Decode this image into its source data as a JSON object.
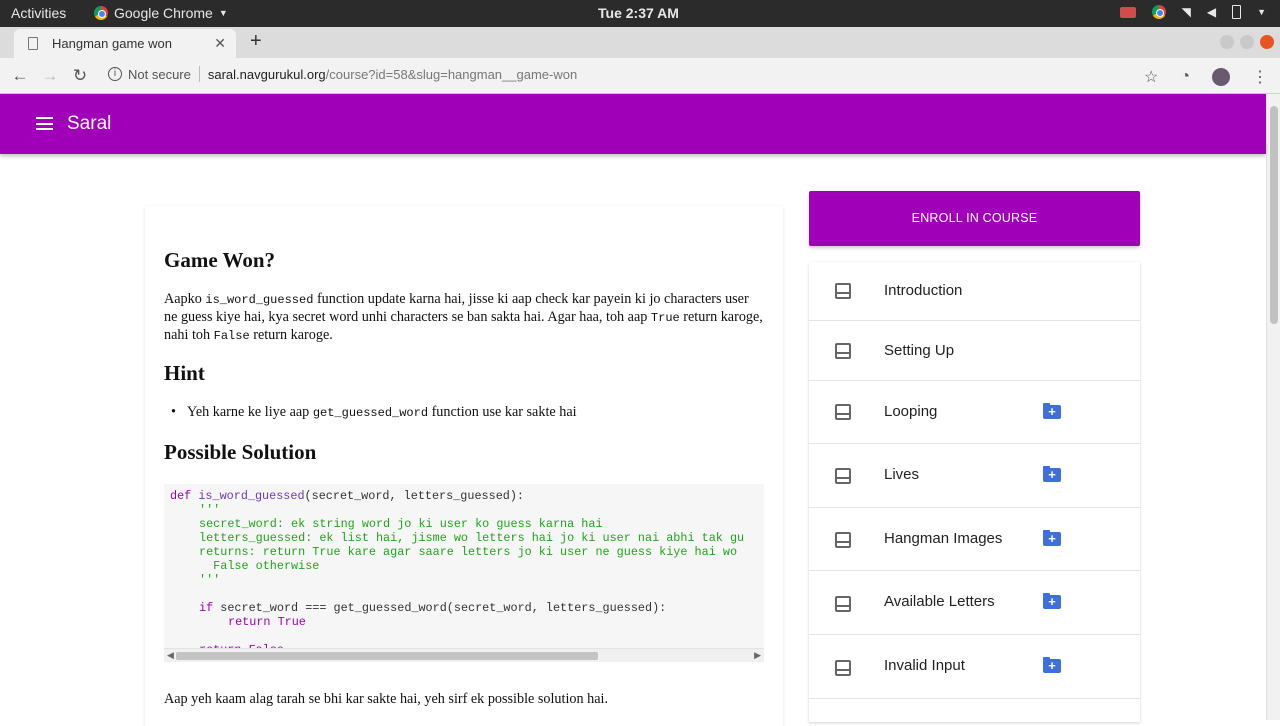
{
  "system_bar": {
    "activities": "Activities",
    "app_name": "Google Chrome",
    "clock": "Tue  2:37 AM"
  },
  "browser": {
    "tab_title": "Hangman game won",
    "security_label": "Not secure",
    "url_host": "saral.navgurukul.org",
    "url_path": "/course?id=58&slug=hangman__game-won"
  },
  "app": {
    "title": "Saral"
  },
  "content": {
    "heading_game_won": "Game Won?",
    "para1": {
      "t1": "Aapko ",
      "c1": "is_word_guessed",
      "t2": " function update karna hai, jisse ki aap check kar payein ki jo characters user ne guess kiye hai, kya secret word unhi characters se ban sakta hai. Agar haa, toh aap ",
      "c2": "True",
      "t3": " return karoge, nahi toh ",
      "c3": "False",
      "t4": " return karoge."
    },
    "heading_hint": "Hint",
    "hint": {
      "t1": "Yeh karne ke liye aap ",
      "c1": "get_guessed_word",
      "t2": " function use kar sakte hai"
    },
    "heading_solution": "Possible Solution",
    "code": {
      "l1_kw": "def",
      "l1_fn": "is_word_guessed",
      "l1_rest": "(secret_word, letters_guessed):",
      "l2": "'''",
      "l3": "secret_word: ek string word jo ki user ko guess karna hai",
      "l4": "letters_guessed: ek list hai, jisme wo letters hai jo ki user nai abhi tak gu",
      "l5": "returns: return True kare agar saare letters jo ki user ne guess kiye hai wo",
      "l6": "  False otherwise",
      "l7": "'''",
      "l8_kw": "if",
      "l8_rest": " secret_word === get_guessed_word(secret_word, letters_guessed):",
      "l9_kw": "return",
      "l9_val": " True",
      "l10_kw": "return",
      "l10_val": " False"
    },
    "closing": "Aap yeh kaam alag tarah se bhi kar sakte hai, yeh sirf ek possible solution hai."
  },
  "sidebar": {
    "enroll_label": "ENROLL IN COURSE",
    "items": [
      {
        "label": "Introduction",
        "has_add": false
      },
      {
        "label": "Setting Up",
        "has_add": false
      },
      {
        "label": "Looping",
        "has_add": true
      },
      {
        "label": "Lives",
        "has_add": true
      },
      {
        "label": "Hangman Images",
        "has_add": true
      },
      {
        "label": "Available Letters",
        "has_add": true
      },
      {
        "label": "Invalid Input",
        "has_add": true
      }
    ]
  },
  "colors": {
    "brand": "#a000b8",
    "add_icon": "#3f6fd9",
    "code_string": "#21a41a"
  }
}
